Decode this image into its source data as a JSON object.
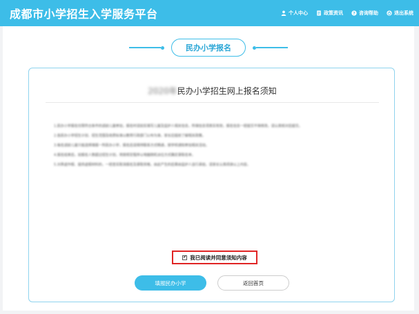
{
  "header": {
    "title": "成都市小学招生入学服务平台",
    "nav": [
      {
        "label": "个人中心",
        "icon": "user-icon"
      },
      {
        "label": "政策资讯",
        "icon": "document-icon"
      },
      {
        "label": "咨询帮助",
        "icon": "help-icon"
      },
      {
        "label": "退出系统",
        "icon": "logout-icon"
      }
    ]
  },
  "section": {
    "heading": "民办小学报名"
  },
  "notice": {
    "title_year": "2020年",
    "title_text": "民办小学招生网上报名须知",
    "paragraphs": [
      "1.民办小学报名仅限符合条件的适龄儿童参加，报名时请如实填写儿童及监护人相关信息，所填信息须真实有效，报名信息一经提交不得修改，请认真核对后提交。",
      "2.各民办小学招生计划、招生范围及收费标准以教育行政部门公布为准，家长应提前了解相关政策。",
      "3.每名适龄儿童只能选择填报一所民办小学，报名后请保持联系方式畅通，按学校通知参加相关活动。",
      "4.报名结束后，如报名人数超过招生计划，将按规定程序以电脑随机派位方式确定录取名单。",
      "5.对弄虚作假、提供虚假材料的，一经查实取消报名及录取资格，由此产生的后果由监护人自行承担。请家长认真阅读以上内容。"
    ]
  },
  "agree": {
    "label": "我已阅读并同意须知内容",
    "checked": true
  },
  "buttons": {
    "fill": "填报民办小学",
    "home": "返回首页"
  },
  "colors": {
    "accent": "#3dbde8",
    "highlight_border": "#e02424"
  }
}
